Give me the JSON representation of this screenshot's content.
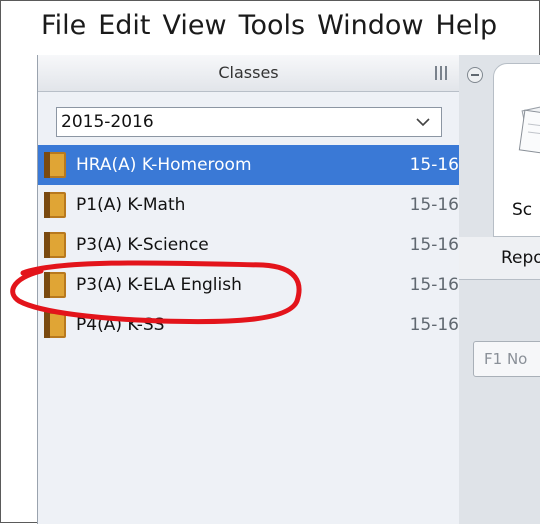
{
  "menu": [
    "File",
    "Edit",
    "View",
    "Tools",
    "Window",
    "Help"
  ],
  "classes_panel": {
    "title": "Classes",
    "year_select": "2015-2016",
    "items": [
      {
        "name": "HRA(A) K-Homeroom",
        "year": "15-16",
        "selected": true
      },
      {
        "name": "P1(A) K-Math",
        "year": "15-16",
        "selected": false
      },
      {
        "name": "P3(A) K-Science",
        "year": "15-16",
        "selected": false
      },
      {
        "name": "P3(A) K-ELA English",
        "year": "15-16",
        "selected": false
      },
      {
        "name": "P4(A) K-SS",
        "year": "15-16",
        "selected": false
      }
    ]
  },
  "right_panel": {
    "card_label": "Sc",
    "report_label": "Repo",
    "key_field": "F1 No"
  },
  "annotation": {
    "color": "#e3141b",
    "target": "P3(A) K-ELA English"
  },
  "colors": {
    "selection": "#3a79d6",
    "panel_bg": "#eef1f6"
  },
  "icons": [
    "book-icon",
    "chevron-down-icon",
    "grip-icon",
    "collapse-icon",
    "document-icon"
  ]
}
